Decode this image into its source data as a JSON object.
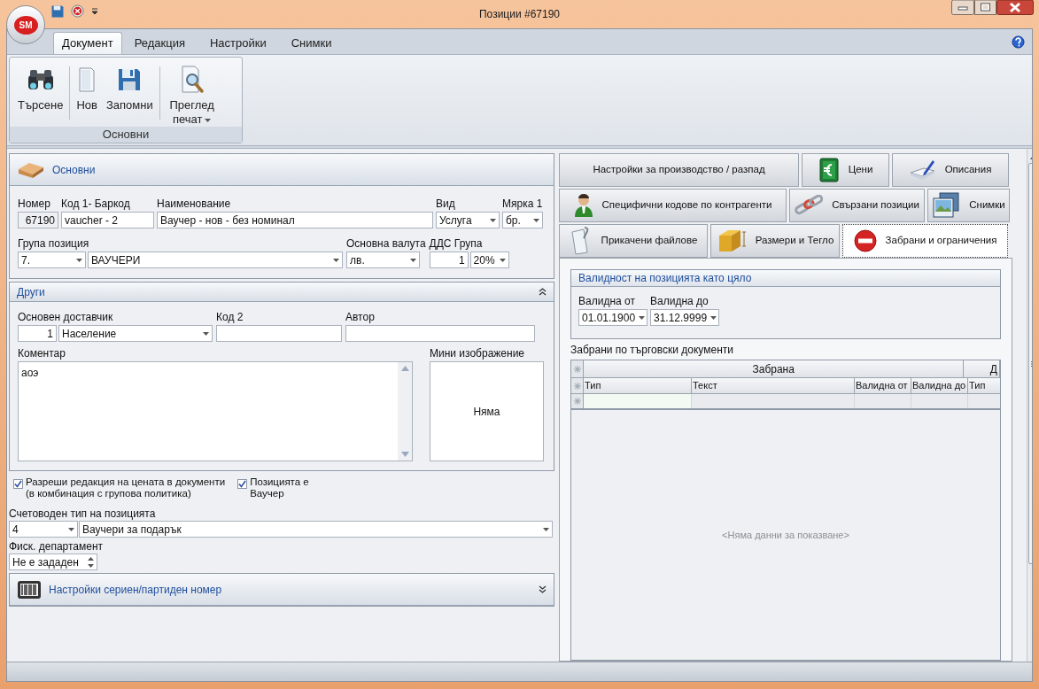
{
  "window": {
    "title": "Позиции #67190",
    "logo": "SM"
  },
  "ribbon": {
    "tabs": [
      {
        "label": "Документ",
        "selected": true
      },
      {
        "label": "Редакция",
        "selected": false
      },
      {
        "label": "Настройки",
        "selected": false
      },
      {
        "label": "Снимки",
        "selected": false
      }
    ],
    "groups": [
      {
        "label": "Основни",
        "buttons": [
          {
            "label": "Търсене",
            "kind": "search"
          },
          {
            "label": "Нов",
            "kind": "new"
          },
          {
            "label": "Запомни",
            "kind": "save"
          },
          {
            "label": "Преглед печат",
            "kind": "preview",
            "dropdown": true
          }
        ]
      }
    ]
  },
  "general": {
    "title": "Основни",
    "fields": [
      {
        "label": "Номер",
        "fields": [
          {
            "kind": "readonly",
            "value": "67190"
          }
        ]
      },
      {
        "label": "Код 1- Баркод",
        "fields": [
          {
            "kind": "text",
            "value": "vaucher - 2"
          }
        ]
      },
      {
        "label": "Наименование",
        "fields": [
          {
            "kind": "text",
            "value": "Ваучер - нов - без номинал"
          }
        ]
      },
      {
        "label": "Вид",
        "fields": [
          {
            "kind": "dropdown",
            "value": "Услуга"
          }
        ]
      },
      {
        "label": "Мярка 1",
        "fields": [
          {
            "kind": "dropdown",
            "value": "бр."
          }
        ]
      },
      {
        "label": "Група позиция",
        "fields": [
          {
            "kind": "dropdown",
            "value": "7."
          },
          {
            "kind": "dropdown",
            "value": "ВАУЧЕРИ"
          }
        ]
      },
      {
        "label": "Основна валута",
        "fields": [
          {
            "kind": "dropdown",
            "value": "лв."
          }
        ]
      },
      {
        "label": "ДДС Група",
        "fields": [
          {
            "kind": "number",
            "value": "1"
          },
          {
            "kind": "dropdown",
            "value": "20%"
          }
        ]
      }
    ]
  },
  "other": {
    "title": "Други",
    "expanded": true,
    "rows": [
      [
        {
          "label": "Основен доставчик",
          "fields": [
            {
              "kind": "number",
              "value": "1"
            },
            {
              "kind": "dropdown",
              "value": "Население"
            }
          ]
        },
        {
          "label": "Код 2",
          "fields": [
            {
              "kind": "text"
            }
          ]
        },
        {
          "label": "Автор",
          "fields": [
            {
              "kind": "text"
            }
          ]
        }
      ]
    ],
    "comment": {
      "label": "Коментар",
      "value": "аоэ"
    },
    "thumbnail": {
      "label": "Мини изображение",
      "text": "Няма"
    }
  },
  "checkboxes": [
    {
      "label": "Разреши редакция на цената в документи\n(в комбинация с групова политика)",
      "checked": true
    },
    {
      "label": "Позицията е\nВаучер",
      "checked": true
    }
  ],
  "accounting_type": {
    "label": "Счетоводен тип на позицията",
    "fields": [
      {
        "kind": "dropdown",
        "value": "4"
      },
      {
        "kind": "dropdown",
        "value": "Ваучери за подарък"
      }
    ]
  },
  "fiscal_department": {
    "label": "Фиск. департамент",
    "fields": [
      {
        "kind": "spin",
        "value": "Не е зададен"
      }
    ]
  },
  "serial_settings": {
    "title": "Настройки сериен/партиден номер",
    "expanded": false
  },
  "detail_tabs": [
    [
      {
        "label": "Настройки за производство / разпад",
        "selected": false
      },
      {
        "label": "Цени",
        "selected": false
      },
      {
        "label": "Описания",
        "selected": false
      }
    ],
    [
      {
        "label": "Специфични кодове по контрагенти",
        "selected": false
      },
      {
        "label": "Свързани позиции",
        "selected": false
      },
      {
        "label": "Снимки",
        "selected": false
      }
    ],
    [
      {
        "label": "Прикачени файлове",
        "selected": false
      },
      {
        "label": "Размери и Тегло",
        "selected": false
      },
      {
        "label": "Забрани и ограничения",
        "selected": true
      }
    ]
  ],
  "restrictions": {
    "validity": {
      "title": "Валидност на позицията като цяло",
      "fields": [
        {
          "label": "Валидна от",
          "value": "01.01.1900"
        },
        {
          "label": "Валидна до",
          "value": "31.12.9999"
        }
      ]
    },
    "grid": {
      "title": "Забрани по търговски документи",
      "bands": [
        "Забрана",
        "Д"
      ],
      "columns": [
        "Тип",
        "Текст",
        "Валидна от",
        "Валидна до",
        "Тип"
      ],
      "empty_text": "<Няма данни за показване>"
    }
  }
}
